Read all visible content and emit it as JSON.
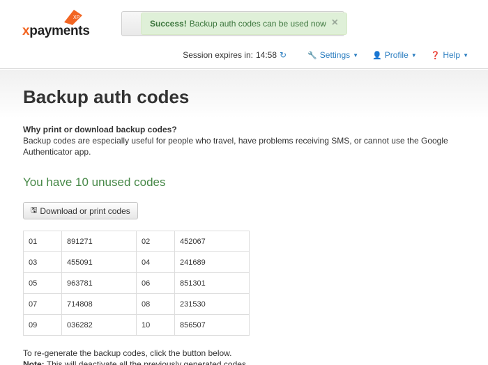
{
  "header": {
    "logo_text": "payments",
    "logo_prefix": "x",
    "logo_mark_text": "XP",
    "alert": {
      "title": "Success!",
      "message": "Backup auth codes can be used now",
      "close": "×"
    },
    "session": {
      "label": "Session expires in:",
      "time": "14:58"
    },
    "nav": [
      {
        "label": "Settings",
        "icon": "wrench-icon"
      },
      {
        "label": "Profile",
        "icon": "user-icon"
      },
      {
        "label": "Help",
        "icon": "question-circle-icon"
      }
    ]
  },
  "main": {
    "title": "Backup auth codes",
    "why_title": "Why print or download backup codes?",
    "why_text": "Backup codes are especially useful for people who travel, have problems receiving SMS, or cannot use the Google Authenticator app.",
    "unused_title": "You have 10 unused codes",
    "download_label": "Download or print codes",
    "codes": [
      {
        "n1": "01",
        "c1": "891271",
        "n2": "02",
        "c2": "452067"
      },
      {
        "n1": "03",
        "c1": "455091",
        "n2": "04",
        "c2": "241689"
      },
      {
        "n1": "05",
        "c1": "963781",
        "n2": "06",
        "c2": "851301"
      },
      {
        "n1": "07",
        "c1": "714808",
        "n2": "08",
        "c2": "231530"
      },
      {
        "n1": "09",
        "c1": "036282",
        "n2": "10",
        "c2": "856507"
      }
    ],
    "regen_text": "To re-generate the backup codes, click the button below.",
    "note_label": "Note:",
    "note_text": "This will deactivate all the previously generated codes."
  },
  "colors": {
    "link": "#2a7dc0",
    "success_bg": "#dff0d8",
    "success_text": "#3c763d",
    "unused_green": "#468847",
    "brand_orange": "#f26522"
  }
}
